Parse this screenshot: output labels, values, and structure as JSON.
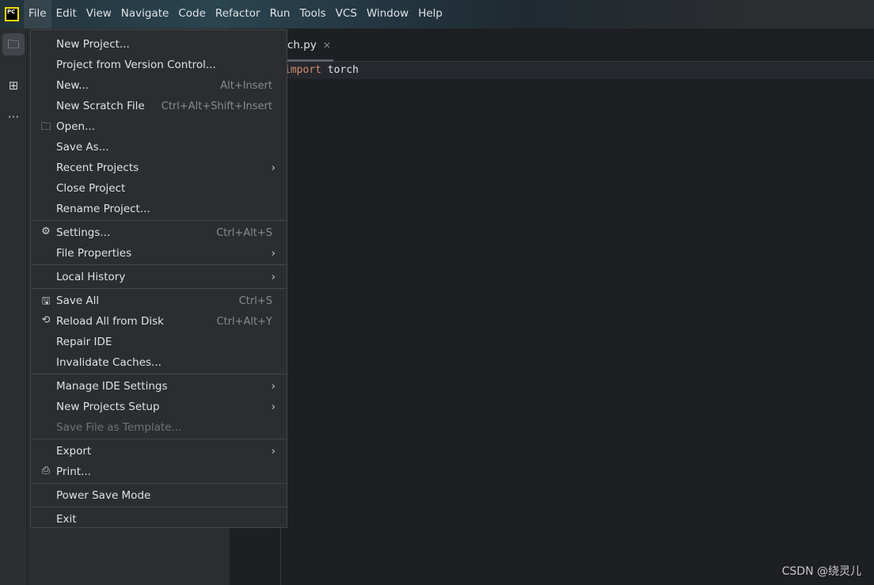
{
  "menubar": {
    "items": [
      {
        "label": "File",
        "active": true
      },
      {
        "label": "Edit"
      },
      {
        "label": "View"
      },
      {
        "label": "Navigate"
      },
      {
        "label": "Code"
      },
      {
        "label": "Refactor"
      },
      {
        "label": "Run"
      },
      {
        "label": "Tools"
      },
      {
        "label": "VCS"
      },
      {
        "label": "Window"
      },
      {
        "label": "Help"
      }
    ],
    "logo": "PC"
  },
  "editor": {
    "tab_label": "ch.py",
    "tab_close": "×",
    "code_keyword": "import",
    "code_rest": " torch"
  },
  "file_menu": {
    "groups": [
      [
        {
          "label": "New Project...",
          "u": 0
        },
        {
          "label": "Project from Version Control..."
        },
        {
          "label": "New...",
          "u": 0,
          "shortcut": "Alt+Insert"
        },
        {
          "label": "New Scratch File",
          "shortcut": "Ctrl+Alt+Shift+Insert"
        },
        {
          "label": "Open...",
          "u": 0,
          "icon": "folder-icon"
        },
        {
          "label": "Save As..."
        },
        {
          "label": "Recent Projects",
          "u": 0,
          "submenu": true
        },
        {
          "label": "Close Project"
        },
        {
          "label": "Rename Project..."
        }
      ],
      [
        {
          "label": "Settings...",
          "u": 2,
          "shortcut": "Ctrl+Alt+S",
          "icon": "gear-icon"
        },
        {
          "label": "File Properties",
          "submenu": true
        }
      ],
      [
        {
          "label": "Local History",
          "u": 6,
          "submenu": true
        }
      ],
      [
        {
          "label": "Save All",
          "u": 0,
          "shortcut": "Ctrl+S",
          "icon": "save-icon"
        },
        {
          "label": "Reload All from Disk",
          "shortcut": "Ctrl+Alt+Y",
          "icon": "reload-icon"
        },
        {
          "label": "Repair IDE"
        },
        {
          "label": "Invalidate Caches..."
        }
      ],
      [
        {
          "label": "Manage IDE Settings",
          "submenu": true
        },
        {
          "label": "New Projects Setup",
          "submenu": true
        },
        {
          "label": "Save File as Template...",
          "disabled": true
        }
      ],
      [
        {
          "label": "Export",
          "submenu": true
        },
        {
          "label": "Print...",
          "u": 0,
          "icon": "print-icon"
        }
      ],
      [
        {
          "label": "Power Save Mode"
        }
      ],
      [
        {
          "label": "Exit",
          "u": 1
        }
      ]
    ]
  },
  "watermark": "CSDN @绕灵儿"
}
